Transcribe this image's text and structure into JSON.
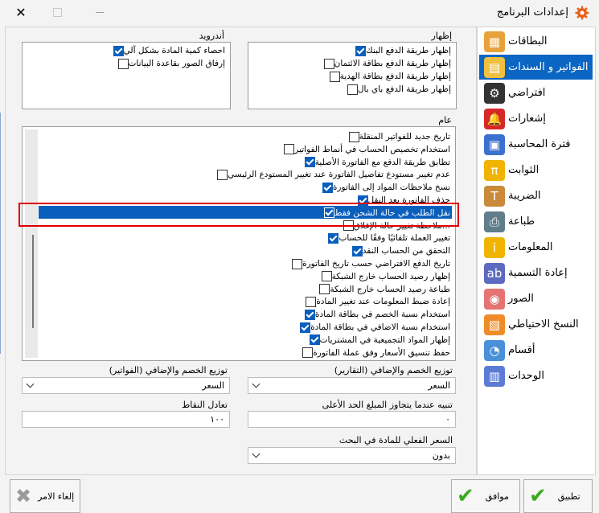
{
  "window": {
    "title": "إعدادات البرنامج"
  },
  "android": {
    "label": "أندرويد",
    "items": [
      {
        "label": "احصاء كمية المادة بشكل آلي",
        "checked": true
      },
      {
        "label": "إرفاق الصور بقاعدة البيانات",
        "checked": false
      }
    ]
  },
  "display": {
    "label": "إظهار",
    "items": [
      {
        "label": "إظهار طريقة الدفع البنك",
        "checked": true
      },
      {
        "label": "إظهار طريقة الدفع بطاقة الائتمان",
        "checked": false
      },
      {
        "label": "إظهار طريقة الدفع بطاقة الهدية",
        "checked": false
      },
      {
        "label": "إظهار طريقة الدفع باي بال",
        "checked": false
      }
    ]
  },
  "general": {
    "label": "عام",
    "items": [
      {
        "label": "تاريخ جديد للفواتير المنقلة",
        "checked": false
      },
      {
        "label": "استخدام تخصيص الحساب في أنماط الفواتير",
        "checked": false
      },
      {
        "label": "تطابق طريقة الدفع مع الفاتورة الأصلية",
        "checked": true
      },
      {
        "label": "عدم تغيير مستودع تفاصيل الفاتورة عند تغيير المستودع الرئيسي",
        "checked": false
      },
      {
        "label": "نسخ ملاحظات المواد إلى الفاتورة",
        "checked": true
      },
      {
        "label": "حذف الفاتورة بعد النقل",
        "checked": true
      },
      {
        "label": "نقل الطلب في حالة الشحن فقط",
        "checked": true,
        "selected": true
      },
      {
        "label": "...ملاحظة تغيير حالة الإغلاق",
        "checked": false
      },
      {
        "label": "تغيير العملة تلقائيًا وفقًا للحساب",
        "checked": true
      },
      {
        "label": "التحقق من الحساب النقد",
        "checked": true
      },
      {
        "label": "تاريخ الدفع الافتراضي حسب تاريخ الفاتورة",
        "checked": false
      },
      {
        "label": "إظهار رصيد الحساب خارج الشبكة",
        "checked": false
      },
      {
        "label": "طباعة رصيد الحساب خارج الشبكة",
        "checked": false
      },
      {
        "label": "إعادة ضبط المعلومات عند تغيير المادة",
        "checked": false
      },
      {
        "label": "استخدام نسبة الخصم في بطاقة المادة",
        "checked": true
      },
      {
        "label": "استخدام نسبة الاضافي في بطاقة المادة",
        "checked": true
      },
      {
        "label": "إظهار المواد التجميعية في المشتريات",
        "checked": true
      },
      {
        "label": "حفظ تنسيق الأسعار وفق عملة الفاتورة",
        "checked": false
      }
    ]
  },
  "fields": {
    "discount_reports": {
      "label": "توزيع الخصم والإضافي (التقارير)",
      "value": "السعر"
    },
    "discount_invoices": {
      "label": "توزيع الخصم والإضافي (الفواتير)",
      "value": "السعر"
    },
    "max_amount_alert": {
      "label": "تنبيه عندما يتجاوز المبلغ الحد الأعلى",
      "value": "٠"
    },
    "points_equivalent": {
      "label": "تعادل النقاط",
      "value": "١٠٠"
    },
    "actual_price_search": {
      "label": "السعر الفعلي للمادة في البحث",
      "value": "بدون"
    }
  },
  "sidebar": {
    "items": [
      {
        "label": "البطاقات",
        "icon": "cards-icon",
        "color": "#e8a23a"
      },
      {
        "label": "الفواتير و السندات",
        "icon": "bills-icon",
        "color": "#f0c040",
        "active": true
      },
      {
        "label": "افتراضي",
        "icon": "gear-icon",
        "color": "#333333"
      },
      {
        "label": "إشعارات",
        "icon": "bell-icon",
        "color": "#d62828"
      },
      {
        "label": "فترة المحاسبة",
        "icon": "calendar-icon",
        "color": "#3b6fd0"
      },
      {
        "label": "الثوابت",
        "icon": "pi-icon",
        "color": "#f0b400"
      },
      {
        "label": "الضريبة",
        "icon": "tax-icon",
        "color": "#c98a3a"
      },
      {
        "label": "طباعة",
        "icon": "printer-icon",
        "color": "#607d8b"
      },
      {
        "label": "المعلومات",
        "icon": "info-icon",
        "color": "#f0b400"
      },
      {
        "label": "إعادة التسمية",
        "icon": "rename-icon",
        "color": "#5c6bc0"
      },
      {
        "label": "الصور",
        "icon": "image-icon",
        "color": "#e57373"
      },
      {
        "label": "النسخ الاحتياطي",
        "icon": "backup-icon",
        "color": "#ef8c2a"
      },
      {
        "label": "أقسام",
        "icon": "pie-chart-icon",
        "color": "#4a90d9"
      },
      {
        "label": "الوحدات",
        "icon": "units-icon",
        "color": "#5b7bd5"
      }
    ]
  },
  "buttons": {
    "apply": "تطبيق",
    "ok": "موافق",
    "cancel": "إلغاء الامر"
  }
}
